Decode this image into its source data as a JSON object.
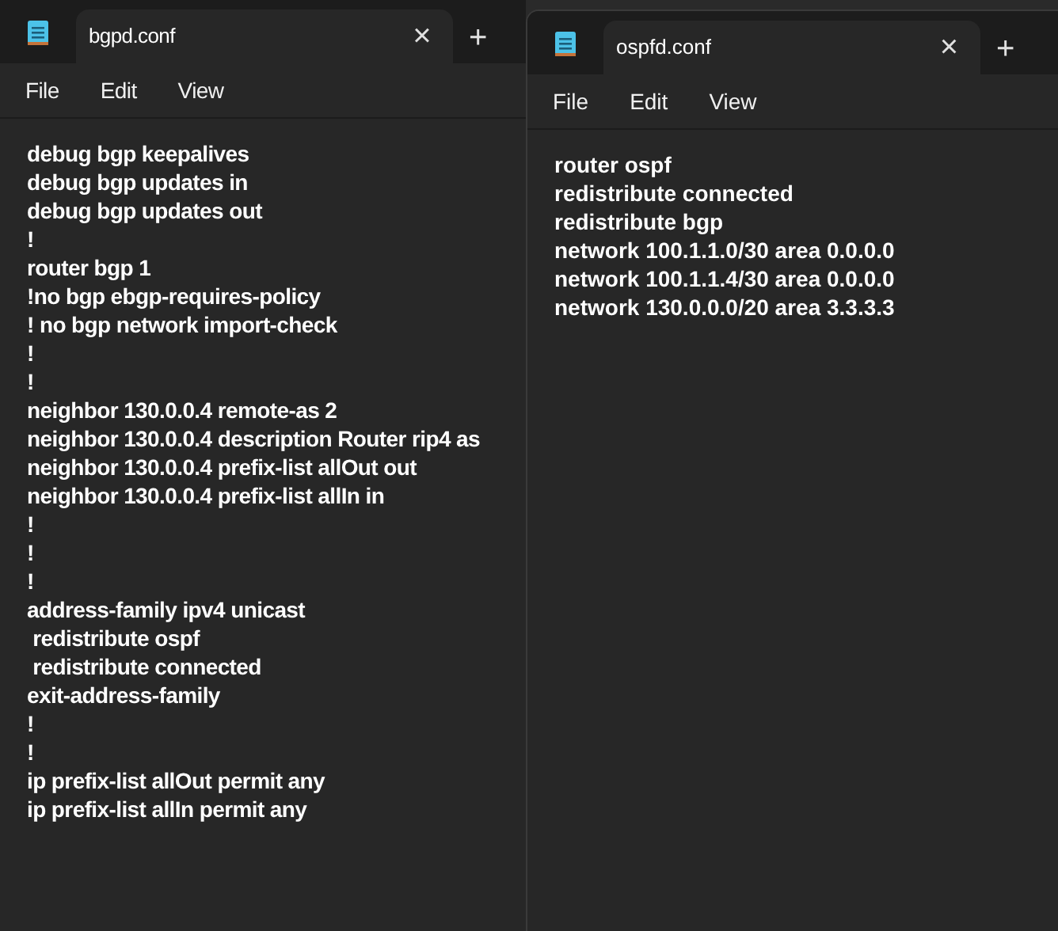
{
  "windows": [
    {
      "tab": {
        "title": "bgpd.conf",
        "close": "×",
        "selected": true
      },
      "new_tab": "+",
      "menu": [
        "File",
        "Edit",
        "View"
      ],
      "lines": [
        "debug bgp keepalives",
        "debug bgp updates in",
        "debug bgp updates out",
        "!",
        "router bgp 1",
        "!no bgp ebgp-requires-policy",
        "! no bgp network import-check",
        "!",
        "!",
        "neighbor 130.0.0.4 remote-as 2",
        "neighbor 130.0.0.4 description Router rip4 as",
        "neighbor 130.0.0.4 prefix-list allOut out",
        "neighbor 130.0.0.4 prefix-list allIn in",
        "!",
        "!",
        "!",
        "address-family ipv4 unicast",
        " redistribute ospf",
        " redistribute connected",
        "exit-address-family",
        "!",
        "!",
        "ip prefix-list allOut permit any",
        "ip prefix-list allIn permit any"
      ]
    },
    {
      "tab": {
        "title": "ospfd.conf",
        "close": "×",
        "selected": true
      },
      "new_tab": "+",
      "menu": [
        "File",
        "Edit",
        "View"
      ],
      "lines": [
        "router ospf",
        "redistribute connected",
        "redistribute bgp",
        "network 100.1.1.0/30 area 0.0.0.0",
        "network 100.1.1.4/30 area 0.0.0.0",
        "network 130.0.0.0/20 area 3.3.3.3"
      ]
    }
  ]
}
